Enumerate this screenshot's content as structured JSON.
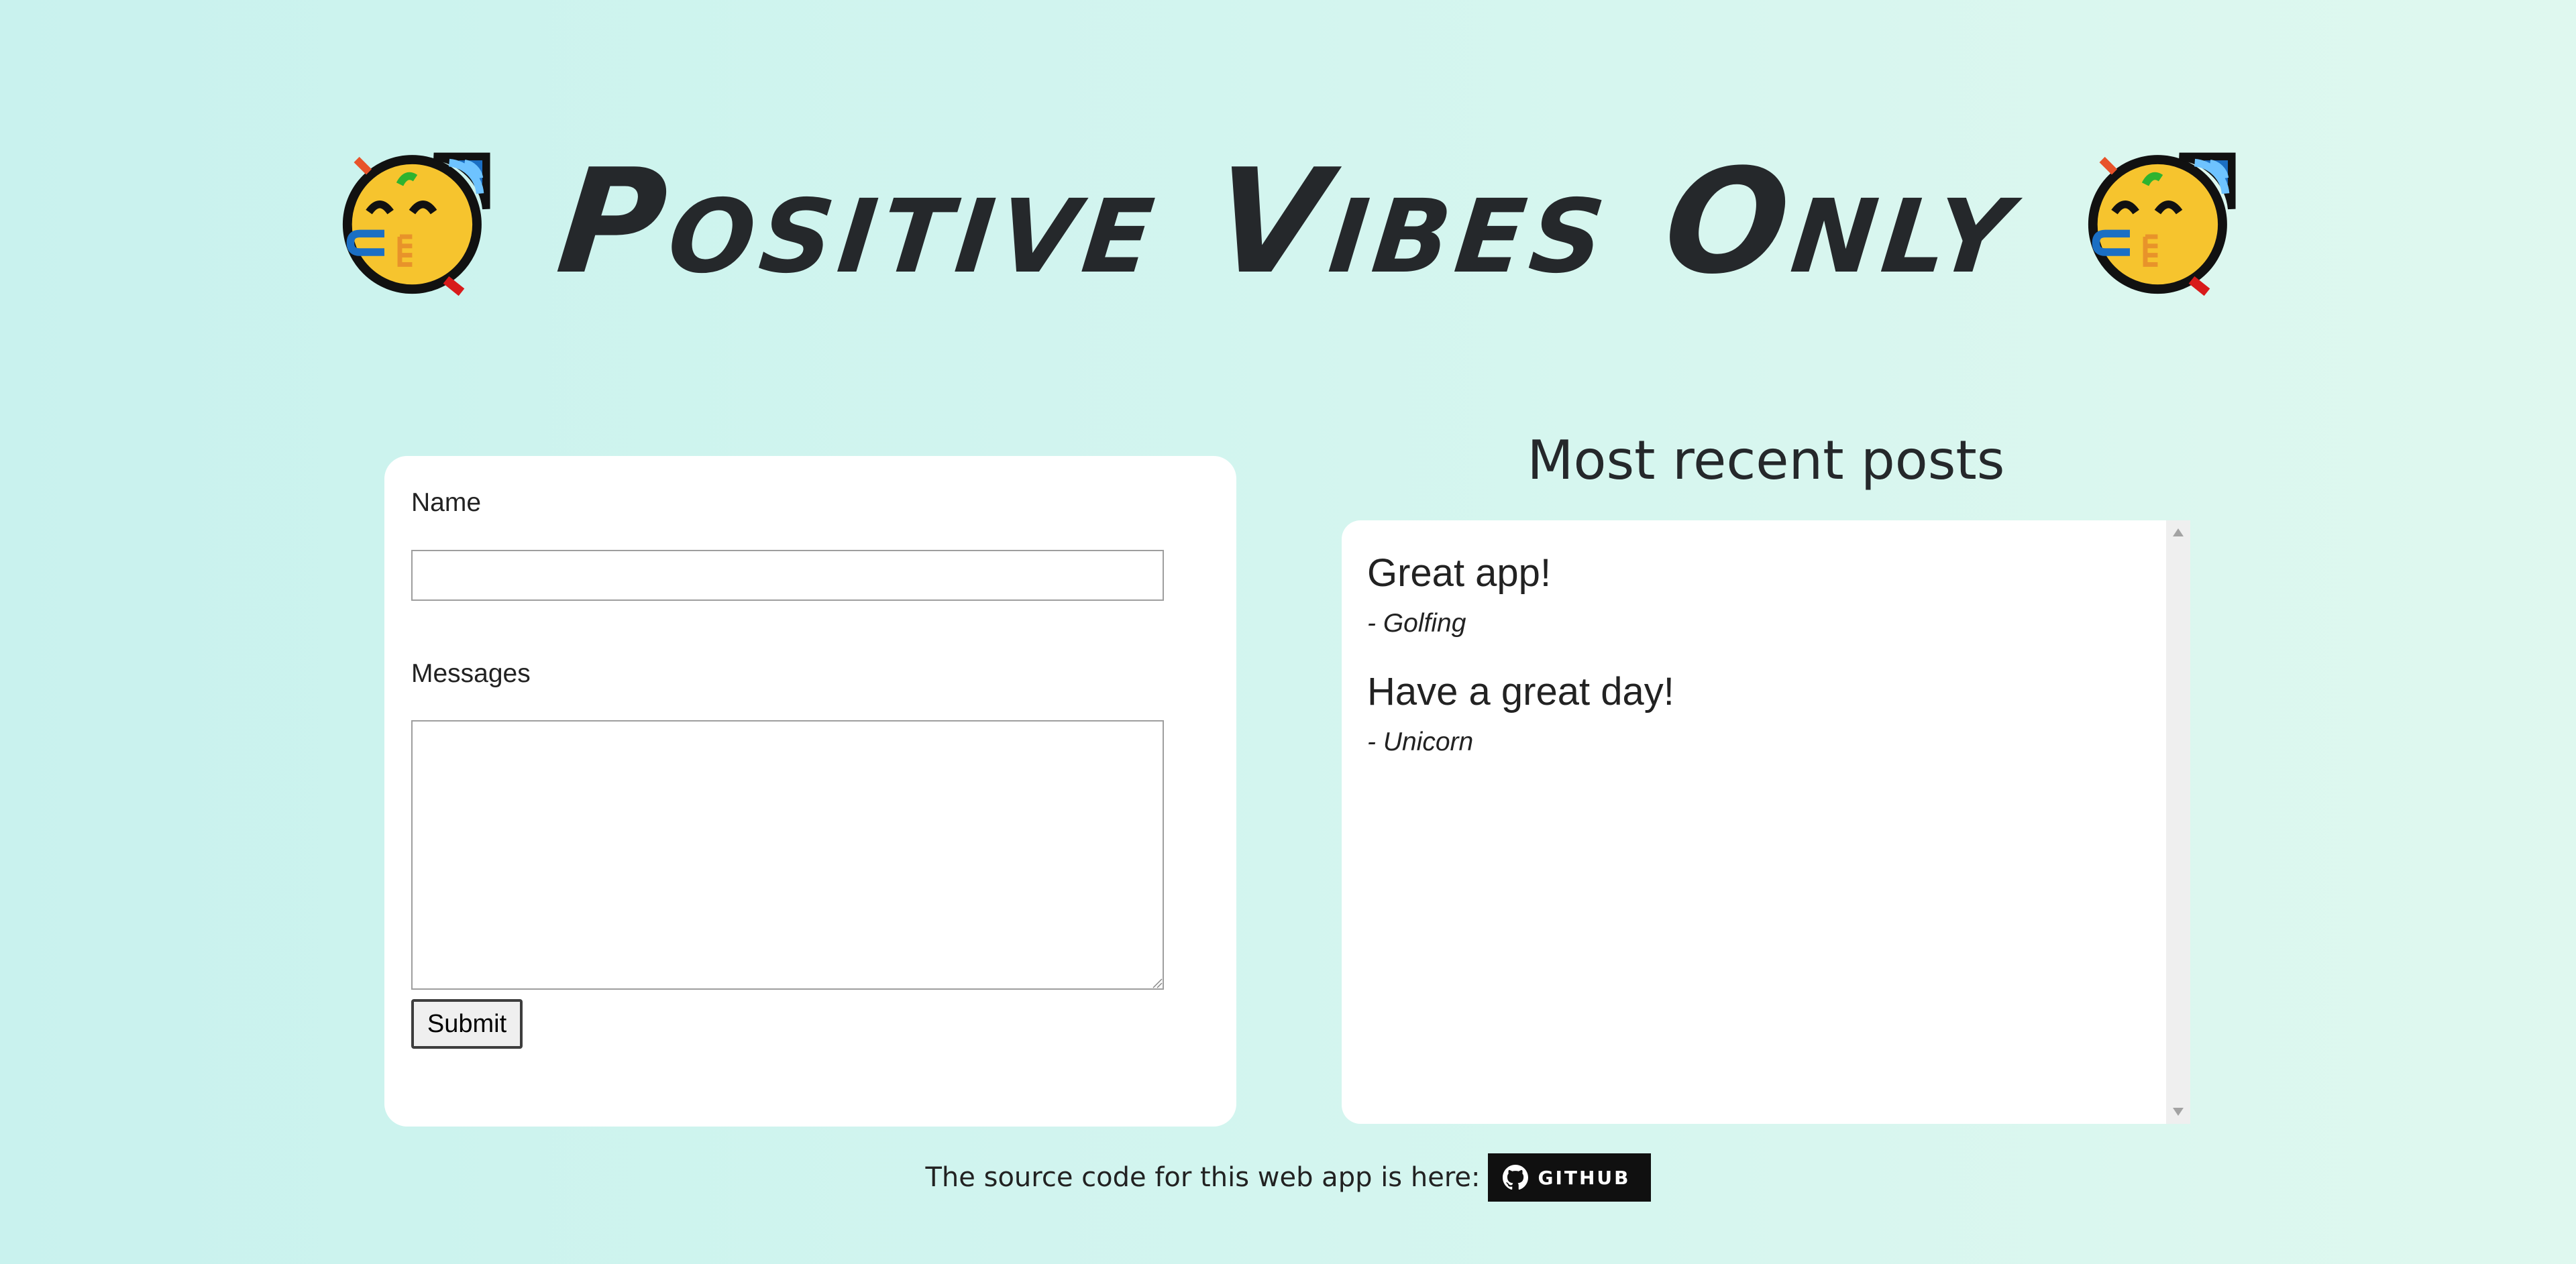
{
  "header": {
    "title": "Positive Vibes Only",
    "emoji": "partying-face-icon"
  },
  "form": {
    "name_label": "Name",
    "name_value": "",
    "name_placeholder": "",
    "messages_label": "Messages",
    "messages_value": "",
    "messages_placeholder": "",
    "submit_label": "Submit"
  },
  "posts": {
    "heading": "Most recent posts",
    "items": [
      {
        "message": "Great app!",
        "author": "- Golfing"
      },
      {
        "message": "Have a great day!",
        "author": "- Unicorn"
      }
    ]
  },
  "footer": {
    "text": "The source code for this web app is here:",
    "badge_label": "GITHUB",
    "badge_icon": "github-icon"
  },
  "colors": {
    "background_left": "#c9f2ee",
    "background_right": "#dff8ef",
    "card": "#ffffff",
    "text": "#25282b",
    "badge_bg": "#101010",
    "emoji_yellow": "#f6c42e",
    "emoji_blue": "#1b6fc4"
  }
}
